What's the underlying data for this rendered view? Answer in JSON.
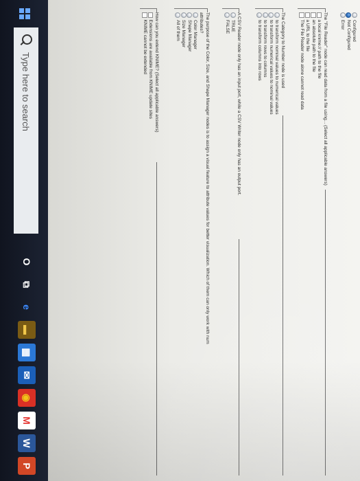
{
  "previous_options": [
    {
      "label": "Configured",
      "checked": false
    },
    {
      "label": "Not Configured",
      "checked": true
    },
    {
      "label": "Error",
      "checked": false
    }
  ],
  "questions": [
    {
      "title": "The \"File Reader\" node can read data from a file using... (Select all applicable answers)",
      "input_type": "checkbox",
      "options": [
        "a local knime:// path to the file",
        "an absolute path to the file",
        "a URL to the file",
        "The File Reader node alone cannot read data"
      ]
    },
    {
      "title": "The Category to Number node is used",
      "input_type": "radio",
      "options": [
        "to transform nominal values to numerical values",
        "to transform numerical values to nominal values",
        "to transform rows to columns",
        "to transform columns into rows"
      ]
    },
    {
      "title": "A CSV Reader node only has an input port, while a CSV Writer node only has an output port.",
      "input_type": "radio",
      "options": [
        "TRUE",
        "FALSE"
      ]
    },
    {
      "title": "The purpose of the Color, Size, and Shape Manager nodes is to assign a visual feature to attribute values for better visualization. Which of them can only work with num",
      "title2": "attributes?",
      "input_type": "radio",
      "options": [
        "Color Manager",
        "Shape Manager",
        "Size Manager",
        "All of them"
      ]
    },
    {
      "title": "How can you extend KNIME? (Select all applicable answers)",
      "input_type": "checkbox",
      "options": [
        "Extensions are available from KNIME update sites",
        "KNIME cannot be extended"
      ]
    }
  ],
  "taskbar": {
    "search_placeholder": "Type here to search",
    "icons": [
      {
        "name": "cortana-icon",
        "glyph": "O",
        "color": "#ffffff",
        "bg": "transparent"
      },
      {
        "name": "task-view-icon",
        "glyph": "⧉",
        "color": "#ffffff",
        "bg": "transparent"
      },
      {
        "name": "edge-icon",
        "glyph": "e",
        "color": "#3d8bff",
        "bg": "transparent"
      },
      {
        "name": "file-explorer-icon",
        "glyph": "▬",
        "color": "#f2c84b",
        "bg": "#7a5b14"
      },
      {
        "name": "store-icon",
        "glyph": "▦",
        "color": "#ffffff",
        "bg": "#2b78d6"
      },
      {
        "name": "mail-icon",
        "glyph": "✉",
        "color": "#ffffff",
        "bg": "#1b5fb8"
      },
      {
        "name": "chrome-icon",
        "glyph": "◉",
        "color": "#f0c419",
        "bg": "#d93025"
      },
      {
        "name": "gmail-icon",
        "glyph": "M",
        "color": "#e53935",
        "bg": "#ffffff"
      },
      {
        "name": "word-icon",
        "glyph": "W",
        "color": "#ffffff",
        "bg": "#2b579a"
      },
      {
        "name": "powerpoint-icon",
        "glyph": "P",
        "color": "#ffffff",
        "bg": "#d24726"
      }
    ]
  }
}
